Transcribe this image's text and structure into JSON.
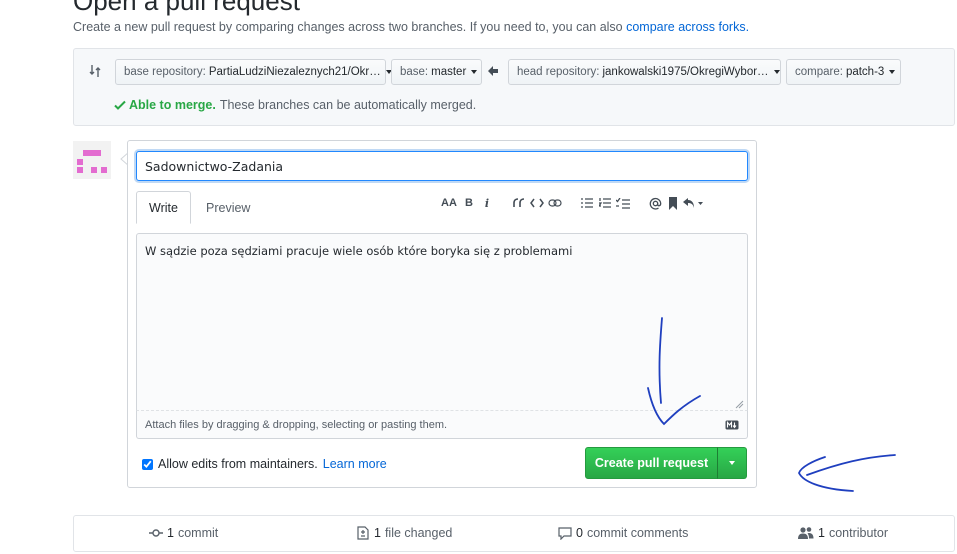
{
  "header": {
    "title": "Open a pull request",
    "description": "Create a new pull request by comparing changes across two branches. If you need to, you can also ",
    "compare_forks_link": "compare across forks."
  },
  "range": {
    "base_repo_label": "base repository:",
    "base_repo_value": "PartiaLudziNiezaleznych21/Okr…",
    "base_label": "base:",
    "base_value": "master",
    "head_repo_label": "head repository:",
    "head_repo_value": "jankowalski1975/OkregiWybor…",
    "compare_label": "compare:",
    "compare_value": "patch-3",
    "merge_ok": "Able to merge.",
    "merge_text": "These branches can be automatically merged."
  },
  "form": {
    "title_value": "Sadownictwo-Zadania",
    "tabs": [
      {
        "label": "Write"
      },
      {
        "label": "Preview"
      }
    ],
    "toolbar": {
      "heading": "AA",
      "bold": "B",
      "italic": "i"
    },
    "body_value": "W sądzie poza sędziami pracuje wiele osób które boryka się z problemami",
    "attach_text": "Attach files by dragging & dropping, selecting or pasting them.",
    "allow_edits_label": "Allow edits from maintainers.",
    "learn_more": "Learn more",
    "create_button": "Create pull request"
  },
  "summary": {
    "commits_count": "1",
    "commits_label": "commit",
    "files_count": "1",
    "files_label": "file changed",
    "comments_count": "0",
    "comments_label": "commit comments",
    "contributors_count": "1",
    "contributors_label": "contributor"
  },
  "colors": {
    "link": "#0366d6",
    "success": "#28a745",
    "annotation": "#1f3fbf",
    "avatar": "#e36cd0"
  }
}
